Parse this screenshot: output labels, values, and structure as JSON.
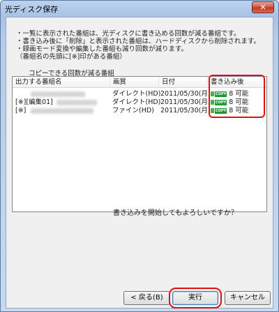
{
  "window": {
    "title": "光ディスク保存",
    "close_glyph": "✕"
  },
  "notes": [
    "・一覧に表示された番組は、光ディスクに書き込める回数が減る番組です。",
    "・書き込み後に「削除」と表示された番組は、ハードディスクから削除されます。",
    "・録画モード変換や編集した番組も減り回数が減ります。",
    "（番組名の先頭に[※]印がある番組）"
  ],
  "section_label": "コピーできる回数が減る番組",
  "list": {
    "columns": [
      "出力する番組名",
      "画質",
      "日付",
      "書き込み後"
    ],
    "rows": [
      {
        "prefix": "",
        "quality": "ダイレクト(HD)",
        "date": "2011/05/30(月)",
        "badge": "COPY",
        "after": "8 可能"
      },
      {
        "prefix": "[※][編集01]",
        "quality": "ダイレクト(HD)",
        "date": "2011/05/30(月)",
        "badge": "COPY",
        "after": "8 可能"
      },
      {
        "prefix": "[※]",
        "quality": "ファイン(HD)",
        "date": "2011/05/30(月)",
        "badge": "COPY",
        "after": "8 可能"
      }
    ]
  },
  "question": "書き込みを開始してもよろしいですか？",
  "buttons": {
    "back": "< 戻る(B)",
    "execute": "実行",
    "cancel": "キャンセル"
  },
  "colors": {
    "highlight": "#e01010",
    "copy_badge": "#1f9a32"
  }
}
